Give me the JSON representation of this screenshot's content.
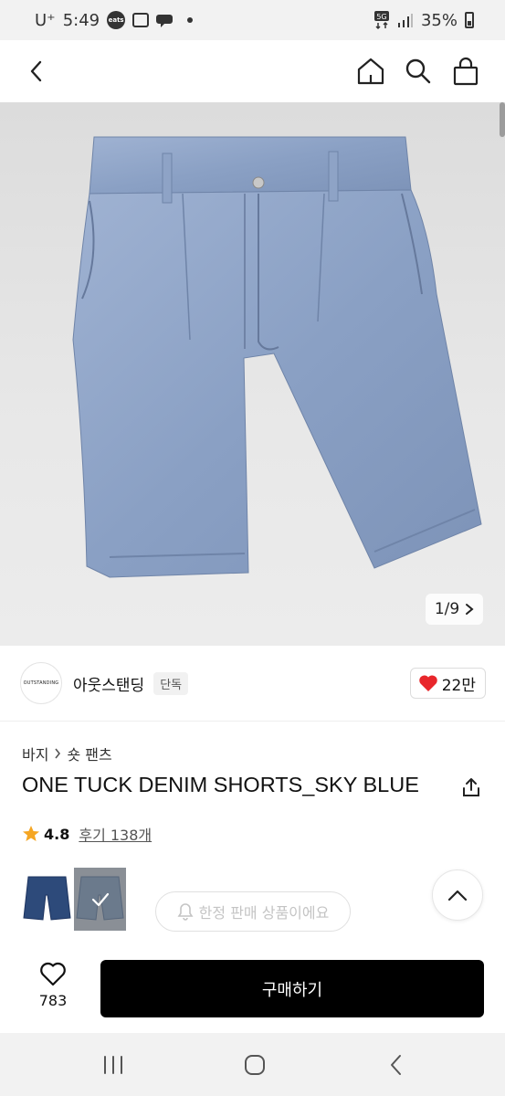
{
  "status_bar": {
    "carrier": "U⁺",
    "time": "5:49",
    "eats_label": "coupang eats",
    "network": "5G",
    "battery": "35%"
  },
  "product": {
    "image_counter": "1/9",
    "brand_logo_text": "OUTSTANDING",
    "brand_name": "아웃스탠딩",
    "brand_badge": "단독",
    "likes": "22만",
    "category_parent": "바지",
    "category_child": "숏 팬츠",
    "title": "ONE TUCK DENIM SHORTS_SKY BLUE",
    "rating": "4.8",
    "reviews": "후기 138개",
    "limited_notice": "한정 판매 상품이에요"
  },
  "action_bar": {
    "wish_count": "783",
    "buy_label": "구매하기"
  },
  "colors": {
    "accent": "#000000",
    "heart": "#e8262b",
    "star": "#f5a623",
    "denim_light": "#8aa0c4",
    "denim_dark": "#2d4a7a"
  }
}
